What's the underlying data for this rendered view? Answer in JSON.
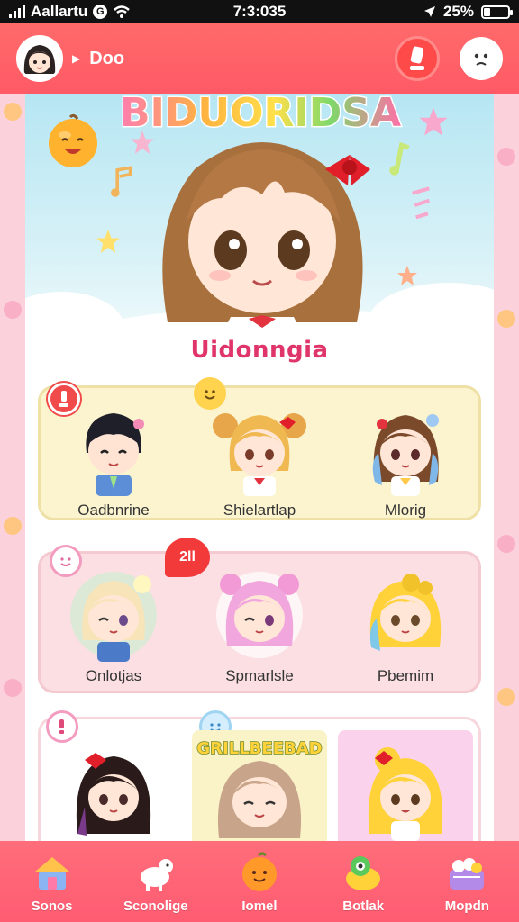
{
  "status_bar": {
    "carrier": "Aallartu",
    "time": "7:3:035",
    "battery_text": "25%",
    "battery_level": 0.25
  },
  "header": {
    "username": "Doo",
    "title_art": "BIDUORIDSA"
  },
  "section": {
    "title": "Uidonngia"
  },
  "groups": [
    {
      "characters": [
        {
          "name": "Oadbnrine"
        },
        {
          "name": "Shielartlap"
        },
        {
          "name": "Mlorig"
        }
      ]
    },
    {
      "badge_text": "2ll",
      "characters": [
        {
          "name": "Onlotjas"
        },
        {
          "name": "Spmarlsle"
        },
        {
          "name": "Pbemim"
        }
      ]
    },
    {
      "banner_text": "GRILLBEEBAD",
      "characters": [
        {
          "name": ""
        },
        {
          "name": ""
        },
        {
          "name": ""
        }
      ]
    }
  ],
  "nav": {
    "items": [
      {
        "label": "Sonos",
        "icon": "house-icon"
      },
      {
        "label": "Sconolige",
        "icon": "sheep-icon"
      },
      {
        "label": "Iomel",
        "icon": "orange-face-icon"
      },
      {
        "label": "Botlak",
        "icon": "creature-icon"
      },
      {
        "label": "Mopdn",
        "icon": "basket-icon"
      }
    ]
  },
  "colors": {
    "header": "#ff5a66",
    "accent_title": "#e0356a",
    "nav": "#ff5c72",
    "group1_bg": "#fbf4cf",
    "group2_bg": "#fbdfe2"
  }
}
